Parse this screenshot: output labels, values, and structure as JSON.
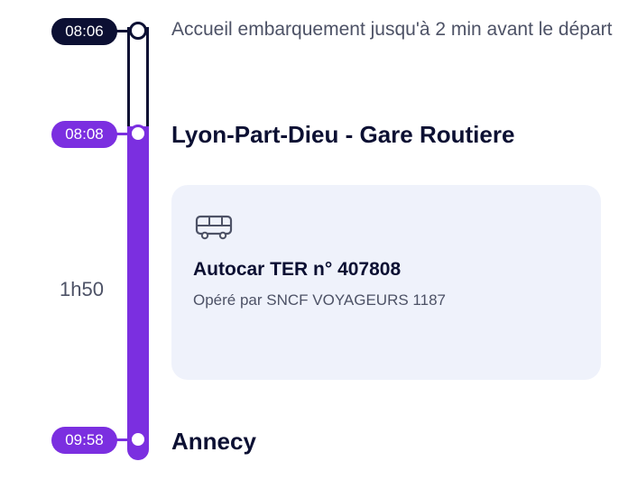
{
  "timeline": {
    "departure_boarding_time": "08:06",
    "boarding_note": "Accueil embarquement jusqu'à 2 min avant le départ",
    "departure_time": "08:08",
    "departure_station": "Lyon-Part-Dieu - Gare Routiere",
    "duration": "1h50",
    "arrival_time": "09:58",
    "arrival_station": "Annecy"
  },
  "segment": {
    "icon": "bus-icon",
    "title": "Autocar TER n° 407808",
    "operator": "Opéré par SNCF VOYAGEURS 1187"
  },
  "colors": {
    "accent": "#7b2fe0",
    "dark": "#0c1033",
    "card_bg": "#eff2fb",
    "muted_text": "#4d5266"
  }
}
